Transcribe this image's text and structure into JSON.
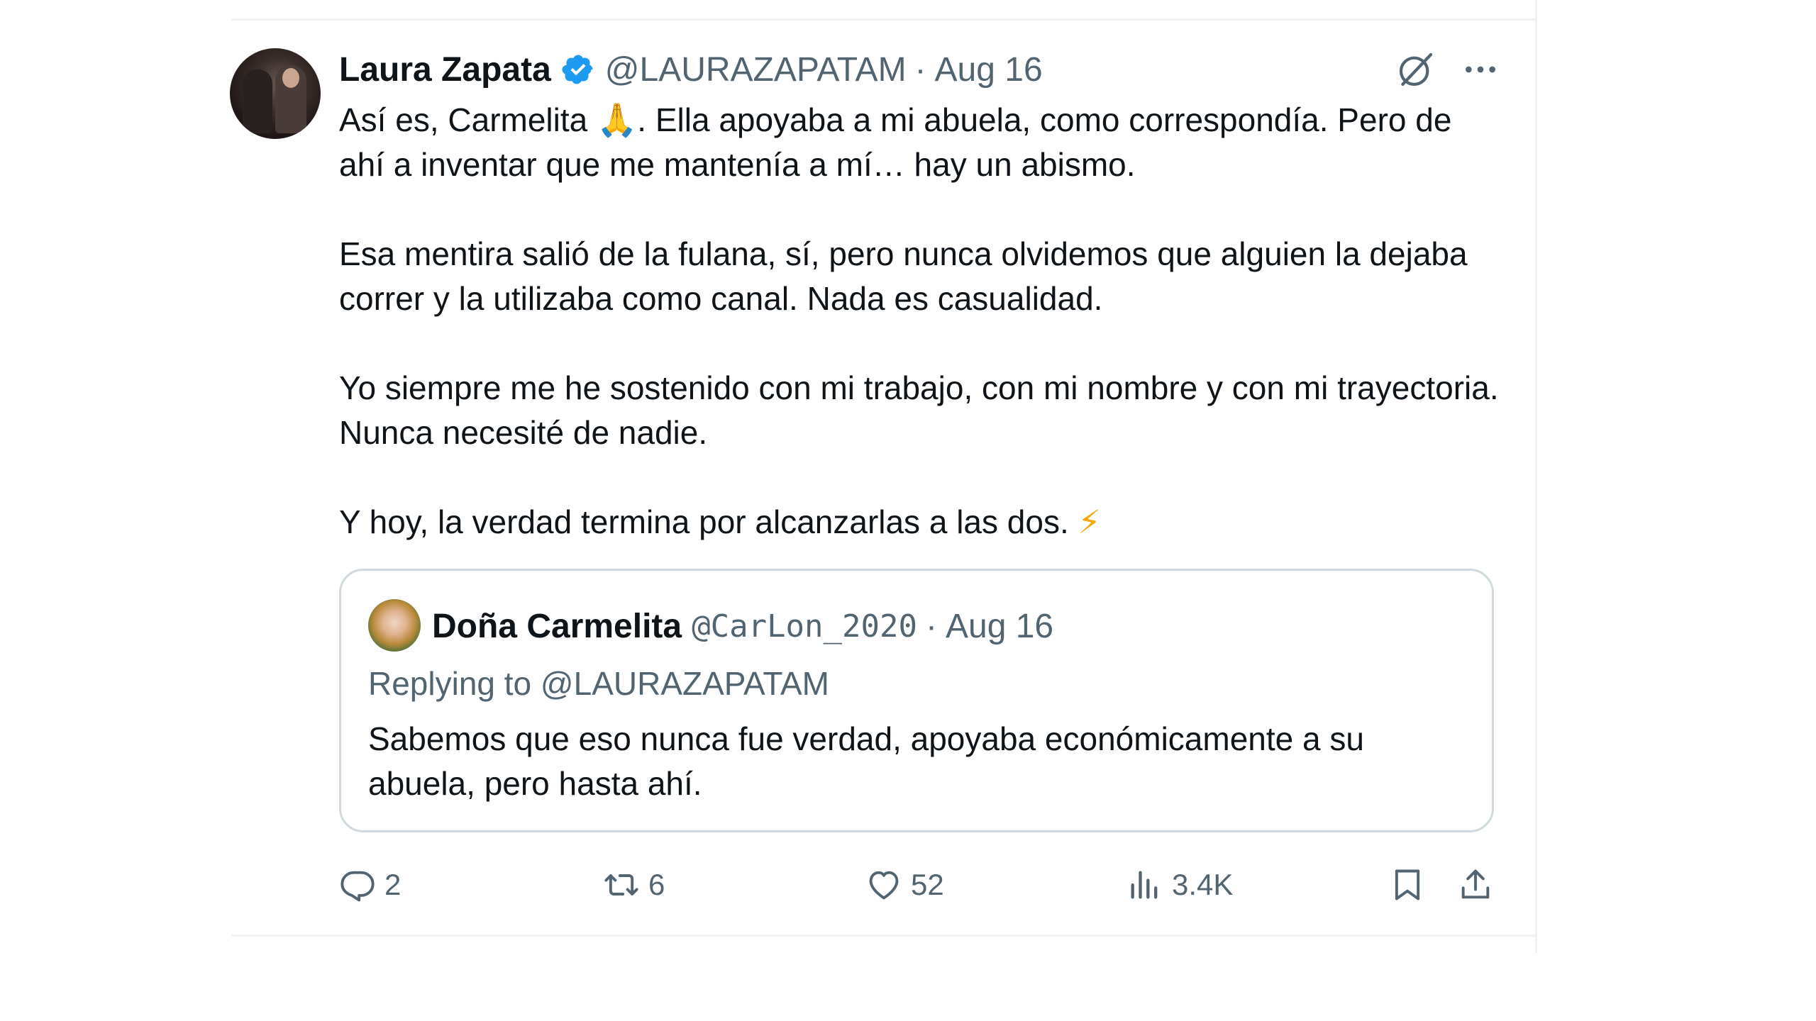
{
  "tweet": {
    "author": {
      "display_name": "Laura Zapata",
      "handle": "@LAURAZAPATAM",
      "verified": true,
      "avatar_icon": "avatar-photo"
    },
    "separator": "·",
    "date": "Aug 16",
    "paragraphs": [
      {
        "before_emoji": "Así es, Carmelita ",
        "emoji": "🙏",
        "after_emoji": ". Ella apoyaba a mi abuela, como correspondía. Pero de ahí a inventar que me mantenía a mí… hay un abismo."
      },
      {
        "text": "Esa mentira salió de la fulana, sí, pero nunca olvidemos que alguien la dejaba correr y la utilizaba como canal. Nada es casualidad."
      },
      {
        "text": "Yo siempre me he sostenido con mi trabajo, con mi nombre y con mi trayectoria. Nunca necesité de nadie."
      },
      {
        "before_emoji": "Y hoy, la verdad termina por alcanzarlas a las dos. ",
        "emoji": "⚡",
        "after_emoji": ""
      }
    ],
    "quoted": {
      "display_name": "Doña Carmelita",
      "handle": "@CarLon_2020",
      "separator": "·",
      "date": "Aug 16",
      "replying_to": "Replying to @LAURAZAPATAM",
      "text": "Sabemos que eso nunca fue verdad, apoyaba económicamente a su abuela, pero hasta ahí."
    },
    "actions": {
      "replies": "2",
      "reposts": "6",
      "likes": "52",
      "views": "3.4K"
    }
  },
  "colors": {
    "text_primary": "#0f1419",
    "text_secondary": "#536471",
    "verified_blue": "#1d9bf0",
    "border": "#cfd9de",
    "divider": "#eff3f4"
  },
  "icons": [
    "grok-icon",
    "more-icon",
    "verified-badge-icon",
    "reply-icon",
    "repost-icon",
    "like-icon",
    "views-icon",
    "bookmark-icon",
    "share-icon"
  ]
}
